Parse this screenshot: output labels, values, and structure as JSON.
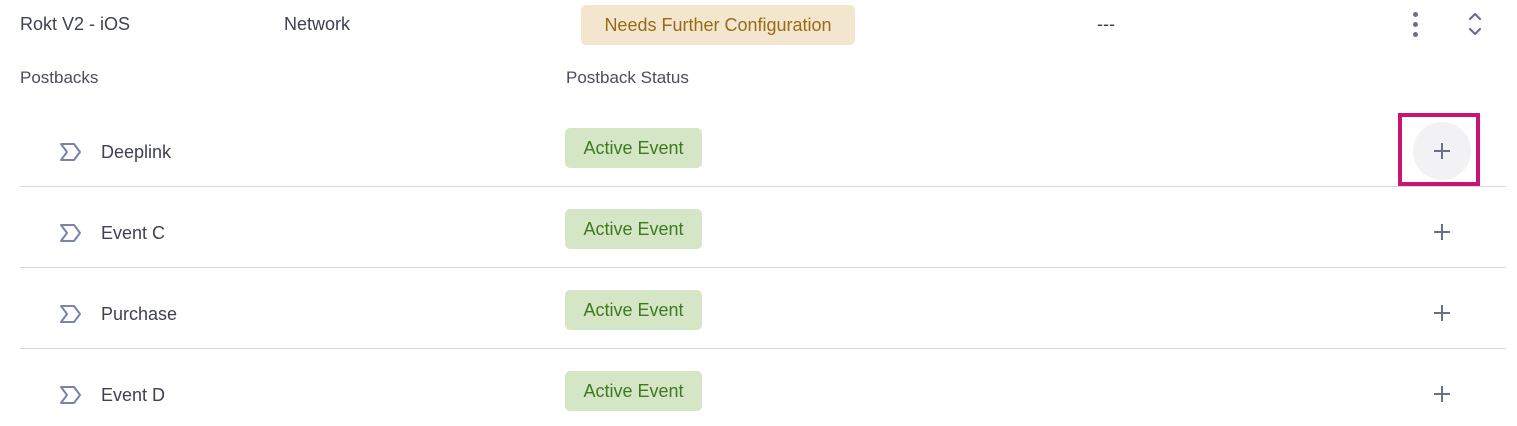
{
  "integration": {
    "name": "Rokt V2 - iOS",
    "type": "Network",
    "status": "Needs Further Configuration",
    "value": "---"
  },
  "columns": {
    "postbacks": "Postbacks",
    "postback_status": "Postback Status"
  },
  "rows": [
    {
      "name": "Deeplink",
      "status": "Active Event"
    },
    {
      "name": "Event C",
      "status": "Active Event"
    },
    {
      "name": "Purchase",
      "status": "Active Event"
    },
    {
      "name": "Event D",
      "status": "Active Event"
    }
  ],
  "icons": {
    "more": "kebab-vertical-icon",
    "expand": "expand-collapse-icon",
    "event": "event-chevron-icon",
    "add": "plus-icon"
  },
  "colors": {
    "warn_bg": "#f3e6cf",
    "warn_text": "#9a6a14",
    "ok_bg": "#d5e6c7",
    "ok_text": "#3d7a1e",
    "highlight": "#c81377"
  }
}
